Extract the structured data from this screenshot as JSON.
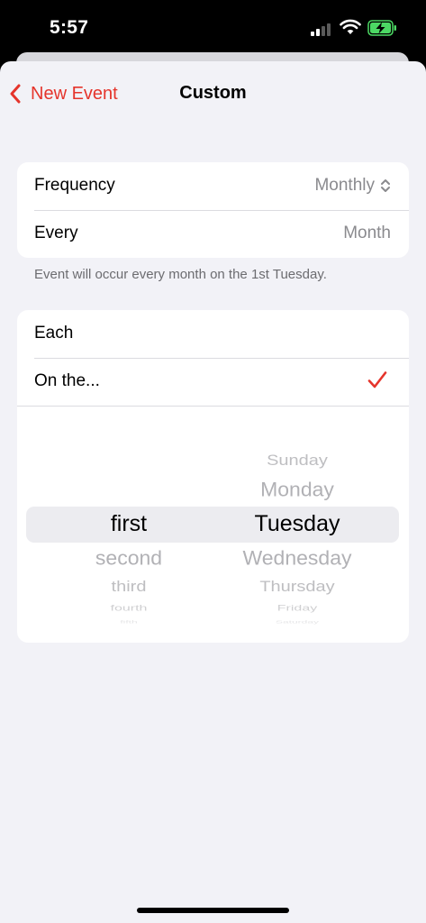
{
  "status_bar": {
    "time": "5:57"
  },
  "nav": {
    "back_label": "New Event",
    "title": "Custom"
  },
  "recurrence": {
    "frequency_label": "Frequency",
    "frequency_value": "Monthly",
    "every_label": "Every",
    "every_value": "Month",
    "summary": "Event will occur every month on the 1st Tuesday."
  },
  "mode": {
    "each_label": "Each",
    "on_the_label": "On the...",
    "selected": "On the..."
  },
  "picker": {
    "ordinals": [
      "first",
      "second",
      "third",
      "fourth",
      "fifth"
    ],
    "selected_ordinal": "first",
    "days": [
      "Sunday",
      "Monday",
      "Tuesday",
      "Wednesday",
      "Thursday",
      "Friday",
      "Saturday"
    ],
    "selected_day": "Tuesday"
  },
  "colors": {
    "accent": "#e5342b",
    "background": "#f2f2f7",
    "secondary_text": "#8a8a8e"
  }
}
